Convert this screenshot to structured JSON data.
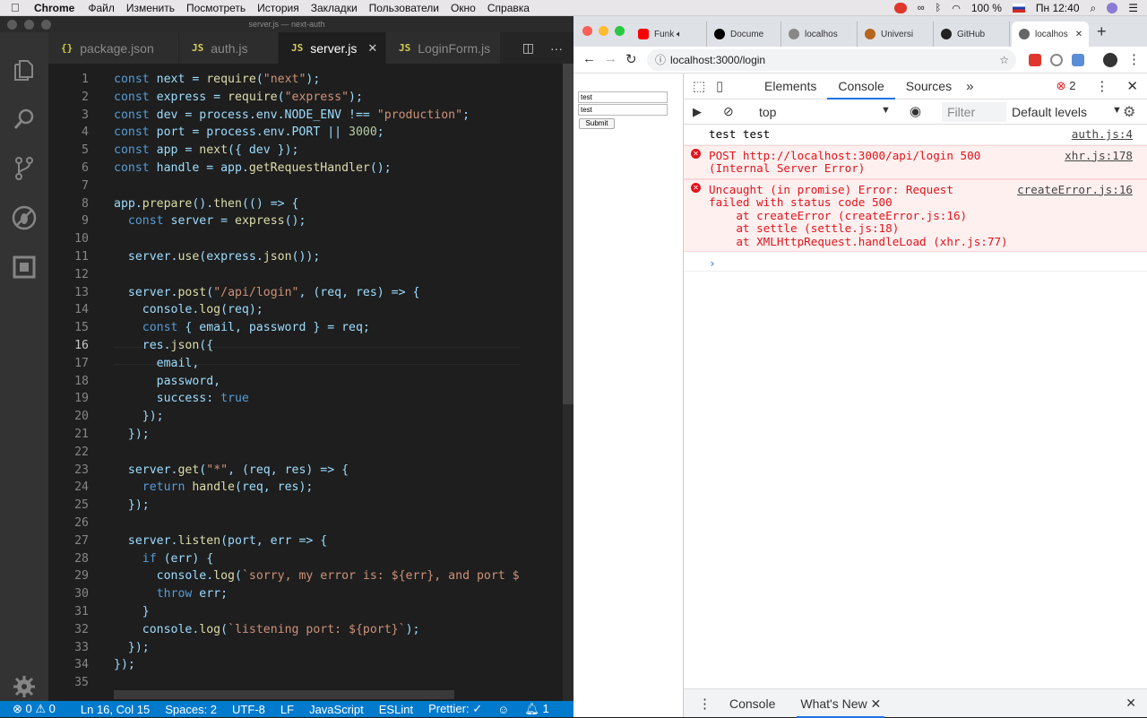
{
  "menubar": {
    "app": "Chrome",
    "items": [
      "Файл",
      "Изменить",
      "Посмотреть",
      "История",
      "Закладки",
      "Пользователи",
      "Окно",
      "Справка"
    ],
    "battery": "100 %",
    "clock": "Пн 12:40"
  },
  "vscode": {
    "window_title": "server.js — next-auth",
    "tabs": [
      {
        "icon": "{}",
        "label": "package.json",
        "active": false
      },
      {
        "icon": "JS",
        "label": "auth.js",
        "active": false
      },
      {
        "icon": "JS",
        "label": "server.js",
        "active": true
      },
      {
        "icon": "JS",
        "label": "LoginForm.js",
        "active": false
      }
    ],
    "current_line": 16,
    "code_lines": [
      "const next = require(\"next\");",
      "const express = require(\"express\");",
      "const dev = process.env.NODE_ENV !== \"production\";",
      "const port = process.env.PORT || 3000;",
      "const app = next({ dev });",
      "const handle = app.getRequestHandler();",
      "",
      "app.prepare().then(() => {",
      "  const server = express();",
      "",
      "  server.use(express.json());",
      "",
      "  server.post(\"/api/login\", (req, res) => {",
      "    console.log(req);",
      "    const { email, password } = req;",
      "    res.json({",
      "      email,",
      "      password,",
      "      success: true",
      "    });",
      "  });",
      "",
      "  server.get(\"*\", (req, res) => {",
      "    return handle(req, res);",
      "  });",
      "",
      "  server.listen(port, err => {",
      "    if (err) {",
      "      console.log(`sorry, my error is: ${err}, and port $",
      "      throw err;",
      "    }",
      "    console.log(`listening port: ${port}`);",
      "  });",
      "});",
      ""
    ],
    "status": {
      "errors": "0",
      "warnings": "0",
      "position": "Ln 16, Col 15",
      "spaces": "Spaces: 2",
      "encoding": "UTF-8",
      "eol": "LF",
      "language": "JavaScript",
      "linter": "ESLint",
      "formatter": "Prettier: ✓",
      "notifications": "1"
    }
  },
  "chrome": {
    "tabs": [
      {
        "label": "Funk",
        "color": "#ff0000"
      },
      {
        "label": "Docume",
        "color": "#000000"
      },
      {
        "label": "localhos",
        "color": "#777777"
      },
      {
        "label": "Universi",
        "color": "#b5651d"
      },
      {
        "label": "GitHub",
        "color": "#222222"
      },
      {
        "label": "localhos",
        "color": "#777777",
        "active": true
      }
    ],
    "url": "localhost:3000/login",
    "page": {
      "email_value": "test",
      "password_value": "test",
      "submit_label": "Submit"
    },
    "devtools": {
      "tabs": [
        "Elements",
        "Console",
        "Sources"
      ],
      "active_tab": "Console",
      "error_count": "2",
      "context": "top",
      "filter_placeholder": "Filter",
      "levels": "Default levels",
      "messages": [
        {
          "type": "log",
          "text": "test test",
          "source": "auth.js:4"
        },
        {
          "type": "error",
          "text": "POST http://localhost:3000/api/login 500\n(Internal Server Error)",
          "source": "xhr.js:178"
        },
        {
          "type": "error",
          "text": "Uncaught (in promise) Error: Request\nfailed with status code 500\n    at createError (createError.js:16)\n    at settle (settle.js:18)\n    at XMLHttpRequest.handleLoad (xhr.js:77)",
          "source": "createError.js:16"
        }
      ],
      "drawer_tabs": [
        "Console",
        "What's New"
      ]
    }
  }
}
